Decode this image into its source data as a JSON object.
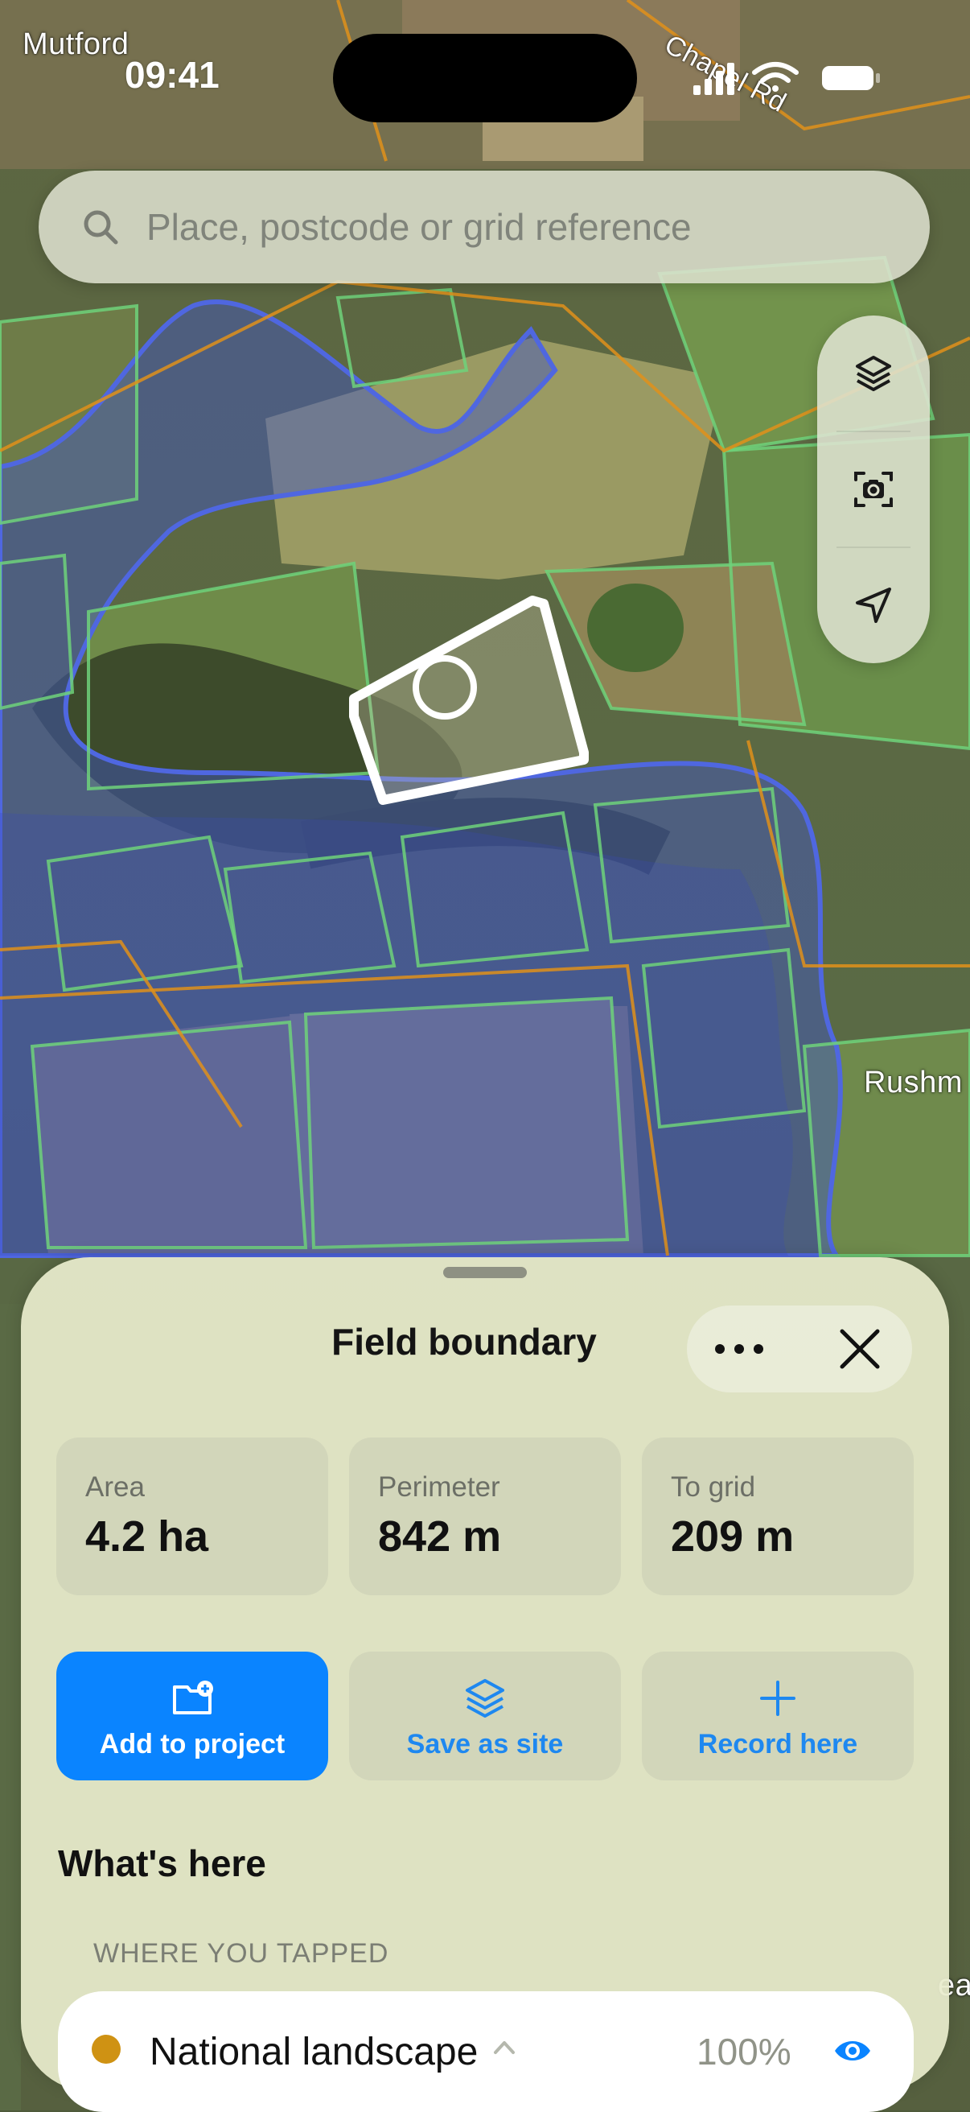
{
  "map": {
    "place_labels": [
      "Mutford",
      "Chapel Rd",
      "Rushm",
      "ea"
    ]
  },
  "status_bar": {
    "time": "09:41"
  },
  "search": {
    "placeholder": "Place, postcode or grid reference",
    "icon": "search-icon"
  },
  "map_controls": {
    "items": [
      {
        "icon": "layers-icon"
      },
      {
        "icon": "camera-icon"
      },
      {
        "icon": "location-arrow-icon"
      }
    ]
  },
  "sheet": {
    "title": "Field boundary",
    "stats": [
      {
        "label": "Area",
        "value": "4.2 ha"
      },
      {
        "label": "Perimeter",
        "value": "842 m"
      },
      {
        "label": "To grid",
        "value": "209 m"
      }
    ],
    "actions": [
      {
        "label": "Add to project",
        "icon": "folder-add-icon"
      },
      {
        "label": "Save as site",
        "icon": "layers-icon"
      },
      {
        "label": "Record here",
        "icon": "plus-icon"
      }
    ],
    "section_heading": "What's here",
    "section_subheading": "WHERE YOU TAPPED",
    "layer": {
      "name": "National landscape",
      "percent": "100%",
      "color": "#cf9213"
    }
  },
  "colors": {
    "accent": "#0a84ff",
    "flood_zone": "#3f55c8",
    "field_outline": "#6fd27a",
    "boundary": "#e0901a"
  }
}
